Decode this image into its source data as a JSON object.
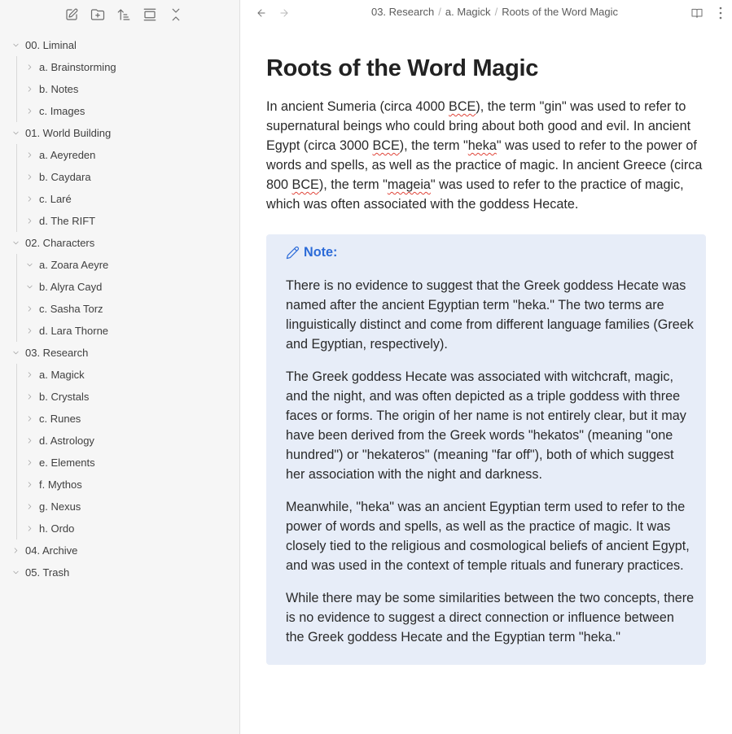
{
  "sidebar": {
    "toolbar": [
      {
        "name": "new-note-icon",
        "label": "New note"
      },
      {
        "name": "new-folder-icon",
        "label": "New folder"
      },
      {
        "name": "sort-icon",
        "label": "Change sort order"
      },
      {
        "name": "auto-reveal-icon",
        "label": "Auto-reveal current file"
      },
      {
        "name": "collapse-all-icon",
        "label": "Collapse all"
      }
    ],
    "tree": [
      {
        "label": "00. Liminal",
        "expanded": true,
        "children": [
          {
            "label": "a. Brainstorming",
            "expanded": false
          },
          {
            "label": "b. Notes",
            "expanded": false
          },
          {
            "label": "c. Images",
            "expanded": false
          }
        ]
      },
      {
        "label": "01. World Building",
        "expanded": true,
        "children": [
          {
            "label": "a. Aeyreden",
            "expanded": false
          },
          {
            "label": "b. Caydara",
            "expanded": false
          },
          {
            "label": "c. Laré",
            "expanded": false
          },
          {
            "label": "d. The RIFT",
            "expanded": false
          }
        ]
      },
      {
        "label": "02. Characters",
        "expanded": true,
        "children": [
          {
            "label": "a. Zoara Aeyre",
            "expanded": true
          },
          {
            "label": "b. Alyra Cayd",
            "expanded": true
          },
          {
            "label": "c. Sasha Torz",
            "expanded": false
          },
          {
            "label": "d. Lara Thorne",
            "expanded": false
          }
        ]
      },
      {
        "label": "03. Research",
        "expanded": true,
        "children": [
          {
            "label": "a. Magick",
            "expanded": false
          },
          {
            "label": "b. Crystals",
            "expanded": false
          },
          {
            "label": "c. Runes",
            "expanded": false
          },
          {
            "label": "d. Astrology",
            "expanded": false
          },
          {
            "label": "e. Elements",
            "expanded": false
          },
          {
            "label": "f. Mythos",
            "expanded": false
          },
          {
            "label": "g. Nexus",
            "expanded": false
          },
          {
            "label": "h. Ordo",
            "expanded": false
          }
        ]
      },
      {
        "label": "04. Archive",
        "expanded": false,
        "children": []
      },
      {
        "label": "05. Trash",
        "expanded": true,
        "children": []
      }
    ]
  },
  "header": {
    "breadcrumb": [
      "03. Research",
      "a. Magick",
      "Roots of the Word Magic"
    ],
    "separator": "/"
  },
  "document": {
    "title": "Roots of the Word Magic",
    "intro": {
      "segments": [
        {
          "text": "In ancient Sumeria (circa 4000 "
        },
        {
          "text": "BCE",
          "misspelled": true
        },
        {
          "text": "), the term \"gin\" was used to refer to supernatural beings who could bring about both good and evil. In ancient Egypt (circa 3000 "
        },
        {
          "text": "BCE",
          "misspelled": true
        },
        {
          "text": "), the term \""
        },
        {
          "text": "heka",
          "misspelled": true
        },
        {
          "text": "\" was used to refer to the power of words and spells, as well as the practice of magic. In ancient Greece (circa 800 "
        },
        {
          "text": "BCE",
          "misspelled": true
        },
        {
          "text": "), the term \""
        },
        {
          "text": "mageia",
          "misspelled": true
        },
        {
          "text": "\" was used to refer to the practice of magic, which was often associated with the goddess Hecate."
        }
      ]
    },
    "callout": {
      "icon": "pencil-icon",
      "title": "Note:",
      "color": "#2c6bd8",
      "background": "#e7edf8",
      "paragraphs": [
        "There is no evidence to suggest that the Greek goddess Hecate was named after the ancient Egyptian term \"heka.\" The two terms are linguistically distinct and come from different language families (Greek and Egyptian, respectively).",
        "The Greek goddess Hecate was associated with witchcraft, magic, and the night, and was often depicted as a triple goddess with three faces or forms. The origin of her name is not entirely clear, but it may have been derived from the Greek words \"hekatos\" (meaning \"one hundred\") or \"hekateros\" (meaning \"far off\"), both of which suggest her association with the night and darkness.",
        "Meanwhile, \"heka\" was an ancient Egyptian term used to refer to the power of words and spells, as well as the practice of magic. It was closely tied to the religious and cosmological beliefs of ancient Egypt, and was used in the context of temple rituals and funerary practices.",
        "While there may be some similarities between the two concepts, there is no evidence to suggest a direct connection or influence between the Greek goddess Hecate and the Egyptian term \"heka.\""
      ]
    }
  },
  "colors": {
    "sidebar_bg": "#f6f6f6",
    "accent": "#2c6bd8",
    "spellcheck": "#e0453a"
  }
}
